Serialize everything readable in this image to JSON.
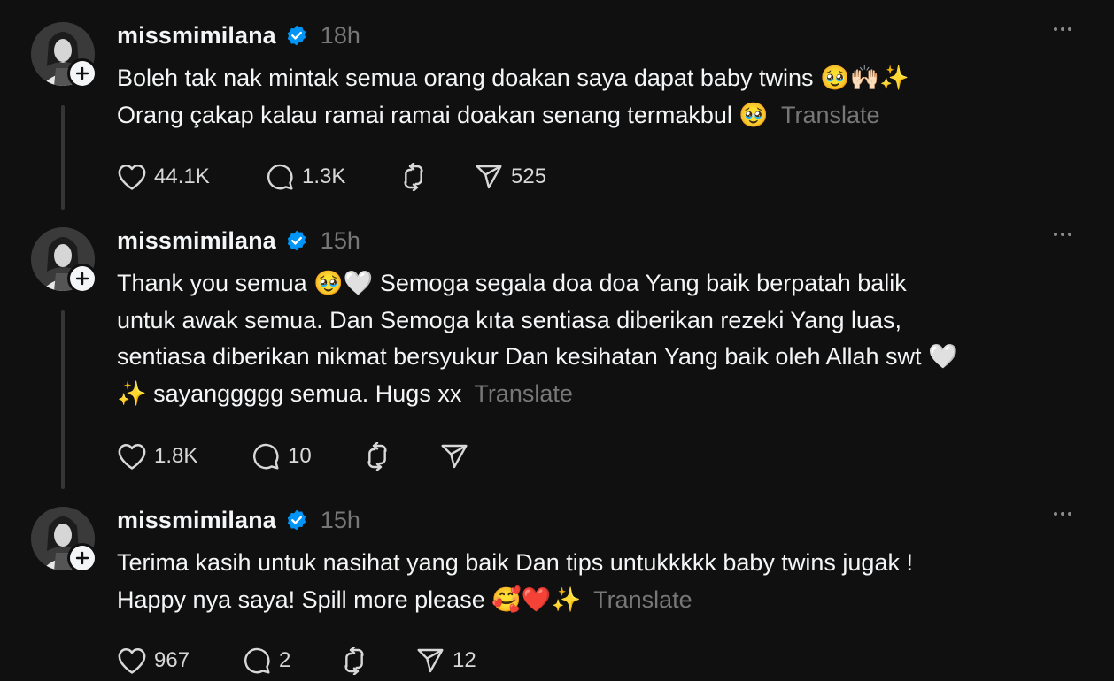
{
  "posts": [
    {
      "username": "missmimilana",
      "timestamp": "18h",
      "lines": [
        "Boleh tak nak mintak semua orang doakan saya dapat baby twins 🥹🙌🏻✨",
        "Orang çakap kalau ramai ramai doakan senang termakbul 🥹"
      ],
      "translate_label": "Translate",
      "likes": "44.1K",
      "replies": "1.3K",
      "reposts": "",
      "shares": "525"
    },
    {
      "username": "missmimilana",
      "timestamp": "15h",
      "lines": [
        "Thank you semua 🥹🤍 Semoga segala doa doa Yang baik berpatah balik",
        "untuk awak semua. Dan Semoga kıta sentiasa diberikan rezeki Yang luas,",
        "sentiasa diberikan nikmat bersyukur Dan kesihatan Yang baik oleh Allah swt 🤍",
        "✨ sayanggggg semua. Hugs xx"
      ],
      "translate_label": "Translate",
      "likes": "1.8K",
      "replies": "10",
      "reposts": "",
      "shares": ""
    },
    {
      "username": "missmimilana",
      "timestamp": "15h",
      "lines": [
        "Terima kasih untuk nasihat yang baik Dan tips untukkkkk baby twins jugak !",
        "Happy nya saya! Spill more please 🥰❤️✨"
      ],
      "translate_label": "Translate",
      "likes": "967",
      "replies": "2",
      "reposts": "",
      "shares": "12"
    }
  ],
  "icons": {
    "verified": "verified-badge-icon",
    "more": "more-options-icon",
    "like": "heart-icon",
    "reply": "comment-icon",
    "repost": "repost-icon",
    "share": "send-icon",
    "follow": "plus-icon"
  },
  "colors": {
    "background": "#101010",
    "text": "#f3f5f7",
    "muted": "#777777",
    "verified": "#0095f6",
    "thread_line": "#333638"
  }
}
